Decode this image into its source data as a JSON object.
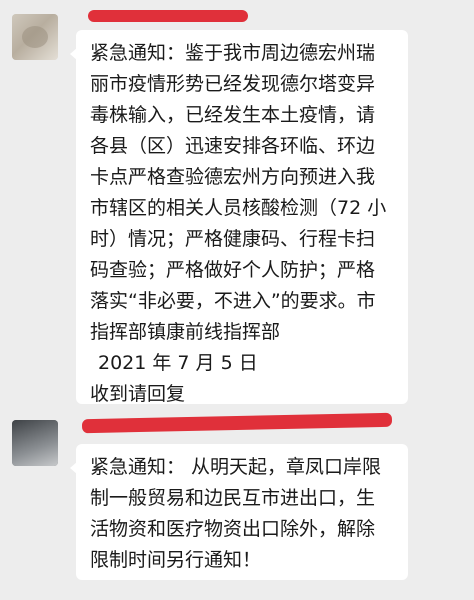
{
  "messages": [
    {
      "lines": [
        "紧急通知：鉴于我市周边德宏州瑞",
        "丽市疫情形势已经发现德尔塔变异",
        "毒株输入，已经发生本土疫情，请",
        "各县（区）迅速安排各环临、环边",
        "卡点严格查验德宏州方向预进入我",
        "市辖区的相关人员核酸检测（72 小",
        "时）情况；严格健康码、行程卡扫",
        "码查验；严格做好个人防护；严格",
        "落实“非必要，不进入”的要求。市",
        "指挥部镇康前线指挥部"
      ],
      "date": "2021 年 7 月 5 日",
      "footer": "收到请回复"
    },
    {
      "lines": [
        "紧急通知：  从明天起，章凤口岸限",
        "制一般贸易和边民互市进出口，生",
        "活物资和医疗物资出口除外，解除",
        "限制时间另行通知！"
      ]
    }
  ]
}
